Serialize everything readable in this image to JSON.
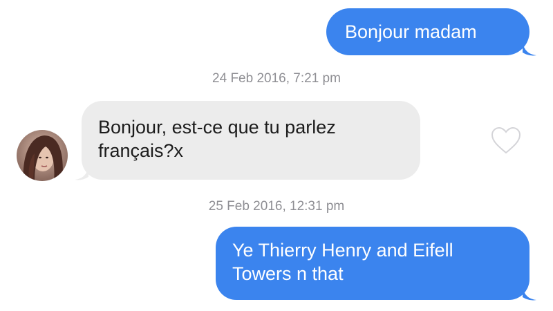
{
  "conversation": {
    "messages": [
      {
        "direction": "outgoing",
        "text": "Bonjour madam"
      },
      {
        "direction": "incoming",
        "timestamp": "24 Feb 2016, 7:21 pm",
        "lines": [
          "Bonjour, est-ce que tu parlez",
          "français?x"
        ]
      },
      {
        "direction": "outgoing",
        "timestamp": "25 Feb 2016, 12:31 pm",
        "lines": [
          "Ye Thierry Henry and Eifell",
          "Towers n that"
        ]
      }
    ]
  },
  "colors": {
    "outgoing_bubble": "#3b84ee",
    "incoming_bubble": "#ececec",
    "timestamp": "#8e8e93"
  },
  "icons": {
    "like": "heart-outline-icon",
    "avatar": "contact-avatar"
  }
}
